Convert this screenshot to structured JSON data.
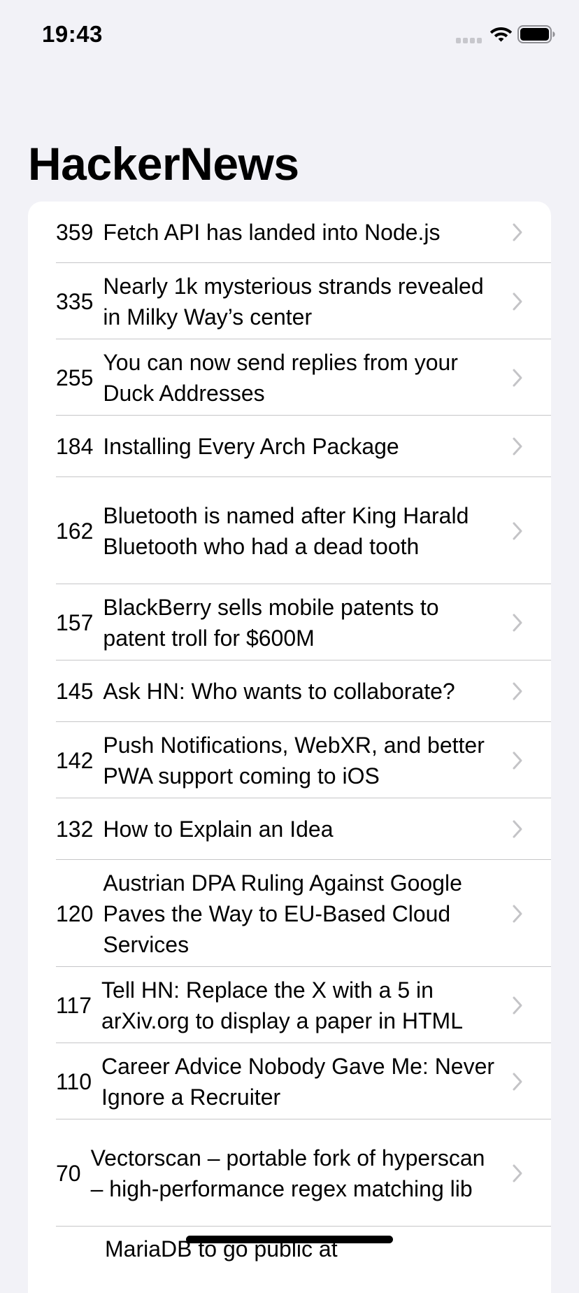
{
  "status_bar": {
    "time": "19:43"
  },
  "header": {
    "title": "HackerNews"
  },
  "stories": [
    {
      "score": "359",
      "title": "Fetch API has landed into Node.js"
    },
    {
      "score": "335",
      "title": "Nearly 1k mysterious strands revealed in Milky Way’s center"
    },
    {
      "score": "255",
      "title": "You can now send replies from your Duck Addresses"
    },
    {
      "score": "184",
      "title": "Installing Every Arch Package"
    },
    {
      "score": "162",
      "title": "Bluetooth is named after King Harald Bluetooth who had a dead tooth"
    },
    {
      "score": "157",
      "title": "BlackBerry sells mobile patents to patent troll for $600M"
    },
    {
      "score": "145",
      "title": "Ask HN: Who wants to collaborate?"
    },
    {
      "score": "142",
      "title": "Push Notifications, WebXR, and better PWA support coming to iOS"
    },
    {
      "score": "132",
      "title": "How to Explain an Idea"
    },
    {
      "score": "120",
      "title": "Austrian DPA Ruling Against Google Paves the Way to EU-Based Cloud Services"
    },
    {
      "score": "117",
      "title": "Tell HN: Replace the X with a 5 in arXiv.org to display a paper in HTML"
    },
    {
      "score": "110",
      "title": "Career Advice Nobody Gave Me: Never Ignore a Recruiter"
    },
    {
      "score": "70",
      "title": "Vectorscan – portable fork of hyperscan – high-performance regex matching lib"
    },
    {
      "score": "",
      "title": "MariaDB to go public at"
    }
  ],
  "icons": {
    "signal": "cellular-signal-icon",
    "wifi": "wifi-icon",
    "battery": "battery-icon",
    "chevron": "chevron-right-icon"
  },
  "colors": {
    "background": "#f2f2f7",
    "separator": "#c6c6c8",
    "chevron": "#c4c4c7"
  }
}
